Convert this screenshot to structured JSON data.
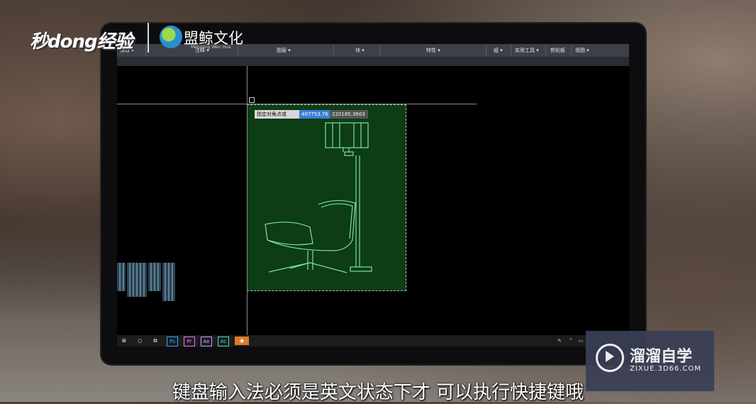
{
  "logo_left": "秒dong经验",
  "logo_right": {
    "name": "盟鲸文化",
    "sub": "Mengjing Wen Hua"
  },
  "ribbon": {
    "modify": "修改 ▾",
    "annotate": "注释 ▾",
    "layers": "图层 ▾",
    "block": "块 ▾",
    "properties": "特性 ▾",
    "group": "组 ▾",
    "utilities": "实用工具 ▾",
    "clipboard": "剪贴板",
    "view": "视图 ▾"
  },
  "cad": {
    "prompt": "指定对角点或",
    "value_x": "407753.76",
    "value_y": "220185.3663"
  },
  "taskbar": {
    "apps": [
      "Ps",
      "Pr",
      "Ae",
      "Ac"
    ]
  },
  "watermark": {
    "title": "溜溜自学",
    "url": "ZIXUE.3D66.COM"
  },
  "subtitle": "键盘输入法必须是英文状态下才 可以执行快捷键哦",
  "colors": {
    "selection": "#0c3d14",
    "drawing": "#7fe0a0",
    "highlight": "#3a7fd9"
  }
}
